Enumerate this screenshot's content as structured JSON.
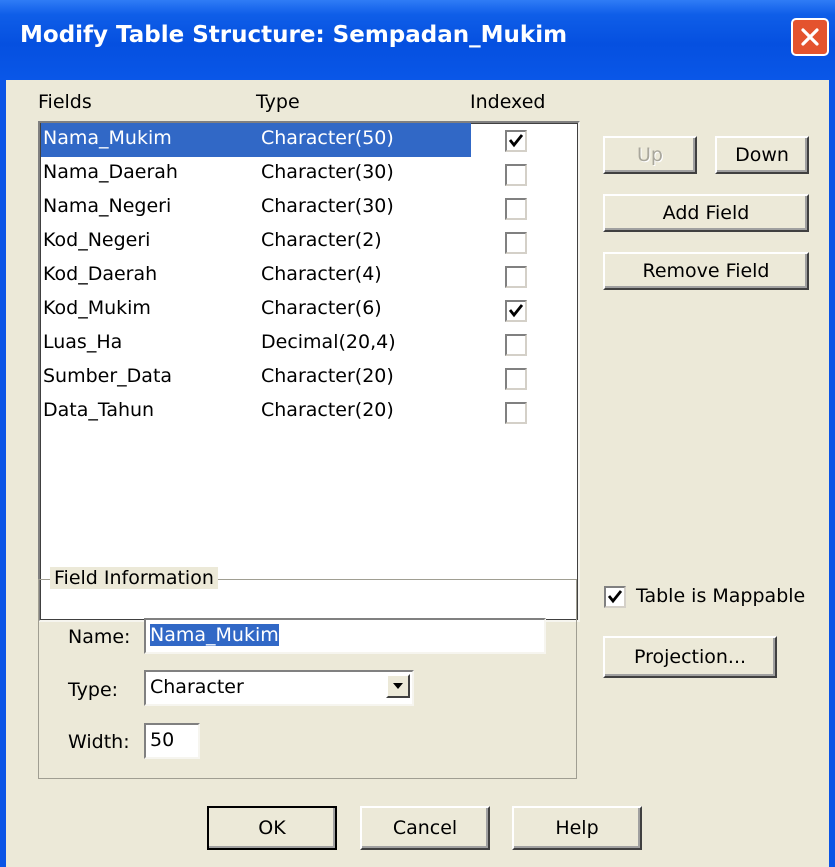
{
  "window": {
    "title": "Modify Table Structure: Sempadan_Mukim"
  },
  "headers": {
    "fields": "Fields",
    "type": "Type",
    "indexed": "Indexed"
  },
  "fields": [
    {
      "name": "Nama_Mukim",
      "type": "Character(50)",
      "indexed": true,
      "selected": true
    },
    {
      "name": "Nama_Daerah",
      "type": "Character(30)",
      "indexed": false
    },
    {
      "name": "Nama_Negeri",
      "type": "Character(30)",
      "indexed": false
    },
    {
      "name": "Kod_Negeri",
      "type": "Character(2)",
      "indexed": false
    },
    {
      "name": "Kod_Daerah",
      "type": "Character(4)",
      "indexed": false
    },
    {
      "name": "Kod_Mukim",
      "type": "Character(6)",
      "indexed": true
    },
    {
      "name": "Luas_Ha",
      "type": "Decimal(20,4)",
      "indexed": false
    },
    {
      "name": "Sumber_Data",
      "type": "Character(20)",
      "indexed": false
    },
    {
      "name": "Data_Tahun",
      "type": "Character(20)",
      "indexed": false
    }
  ],
  "buttons": {
    "up": "Up",
    "down": "Down",
    "add_field": "Add Field",
    "remove_field": "Remove Field",
    "projection": "Projection...",
    "ok": "OK",
    "cancel": "Cancel",
    "help": "Help"
  },
  "field_info": {
    "group_label": "Field Information",
    "name_label": "Name:",
    "name_value": "Nama_Mukim",
    "type_label": "Type:",
    "type_value": "Character",
    "width_label": "Width:",
    "width_value": "50"
  },
  "mappable": {
    "label": "Table is Mappable",
    "checked": true
  },
  "colors": {
    "titlebar": "#0550e0",
    "selection": "#3168c6",
    "dialog_bg": "#ece9d8",
    "close": "#e4532e"
  }
}
